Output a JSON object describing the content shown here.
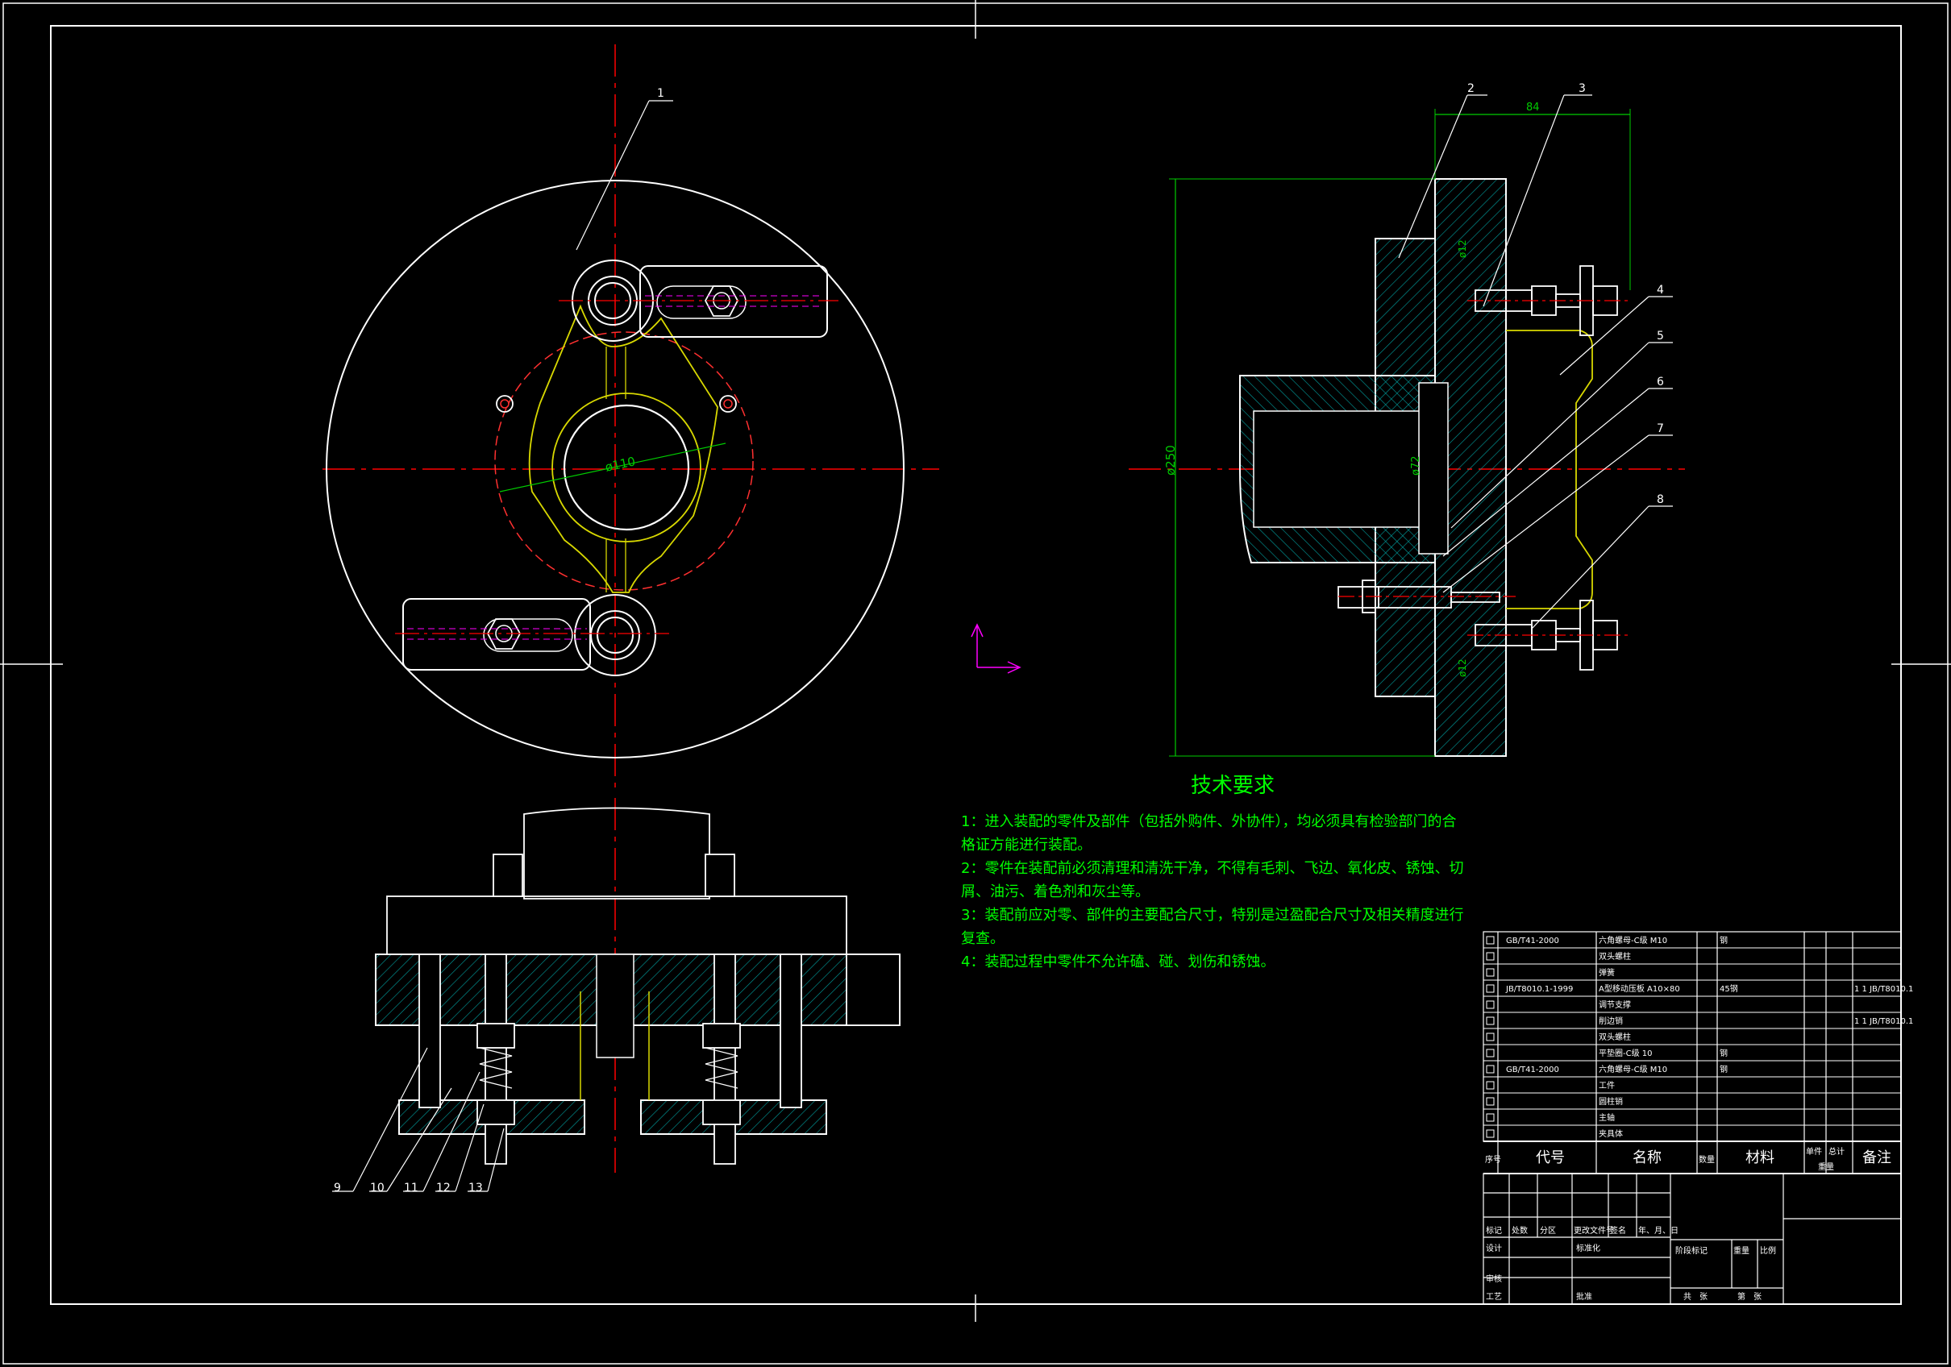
{
  "tech_requirements": {
    "title": "技术要求",
    "items": [
      "1：进入装配的零件及部件（包括外购件、外协件），均必须具有检验部门的合",
      "格证方能进行装配。",
      "2：零件在装配前必须清理和清洗干净，不得有毛刺、飞边、氧化皮、锈蚀、切",
      "屑、油污、着色剂和灰尘等。",
      "3：装配前应对零、部件的主要配合尺寸，特别是过盈配合尺寸及相关精度进行",
      "复查。",
      "4：装配过程中零件不允许磕、碰、划伤和锈蚀。"
    ]
  },
  "dimensions": {
    "dim_84": "84",
    "dim_250": "ø250",
    "dim_110": "ø110",
    "dim_72": "ø72",
    "dim_12a": "ø12",
    "dim_12b": "ø12"
  },
  "balloons": [
    "1",
    "2",
    "3",
    "4",
    "5",
    "6",
    "7",
    "8",
    "9",
    "10",
    "11",
    "12",
    "13"
  ],
  "bom": {
    "rows": [
      {
        "code": "GB/T41-2000",
        "name": "六角螺母-C级 M10",
        "qty": "",
        "mat": "钢",
        "note": ""
      },
      {
        "code": "",
        "name": "双头螺柱",
        "qty": "",
        "mat": "",
        "note": ""
      },
      {
        "code": "",
        "name": "弹簧",
        "qty": "",
        "mat": "",
        "note": ""
      },
      {
        "code": "JB/T8010.1-1999",
        "name": "A型移动压板 A10×80",
        "qty": "",
        "mat": "45钢",
        "note": "1 1 JB/T8010.1"
      },
      {
        "code": "",
        "name": "调节支撑",
        "qty": "",
        "mat": "",
        "note": ""
      },
      {
        "code": "",
        "name": "削边销",
        "qty": "",
        "mat": "",
        "note": "1 1 JB/T8010.1"
      },
      {
        "code": "",
        "name": "双头螺柱",
        "qty": "",
        "mat": "",
        "note": ""
      },
      {
        "code": "",
        "name": "平垫圈-C级 10",
        "qty": "",
        "mat": "钢",
        "note": ""
      },
      {
        "code": "GB/T41-2000",
        "name": "六角螺母-C级 M10",
        "qty": "",
        "mat": "钢",
        "note": ""
      },
      {
        "code": "",
        "name": "工件",
        "qty": "",
        "mat": "",
        "note": ""
      },
      {
        "code": "",
        "name": "圆柱销",
        "qty": "",
        "mat": "",
        "note": ""
      },
      {
        "code": "",
        "name": "主轴",
        "qty": "",
        "mat": "",
        "note": ""
      },
      {
        "code": "",
        "name": "夹具体",
        "qty": "",
        "mat": "",
        "note": ""
      }
    ],
    "header": {
      "no": "序号",
      "code": "代号",
      "name": "名称",
      "qty": "数量",
      "mat": "材料",
      "unit_weight": "单件",
      "total_weight": "总计",
      "weight": "重量",
      "note": "备注"
    }
  },
  "title_block": {
    "mark": "标记",
    "count": "处数",
    "zone": "分区",
    "change_doc": "更改文件号",
    "signature": "签名",
    "date": "年、月、日",
    "design": "设计",
    "standardize": "标准化",
    "stage_mark": "阶段标记",
    "weight": "重量",
    "scale": "比例",
    "review": "审核",
    "process": "工艺",
    "approve": "批准",
    "sheets_total": "共　张",
    "sheet_no": "第　张"
  },
  "colors": {
    "background": "#000000",
    "outline": "#ffffff",
    "centerline": "#ff0000",
    "hatch": "#00a0a0",
    "dimension": "#00cc00",
    "text_green": "#00ff00",
    "workpiece": "#d8d800",
    "hidden": "#ff00ff",
    "dashed_red": "#ff3030"
  }
}
